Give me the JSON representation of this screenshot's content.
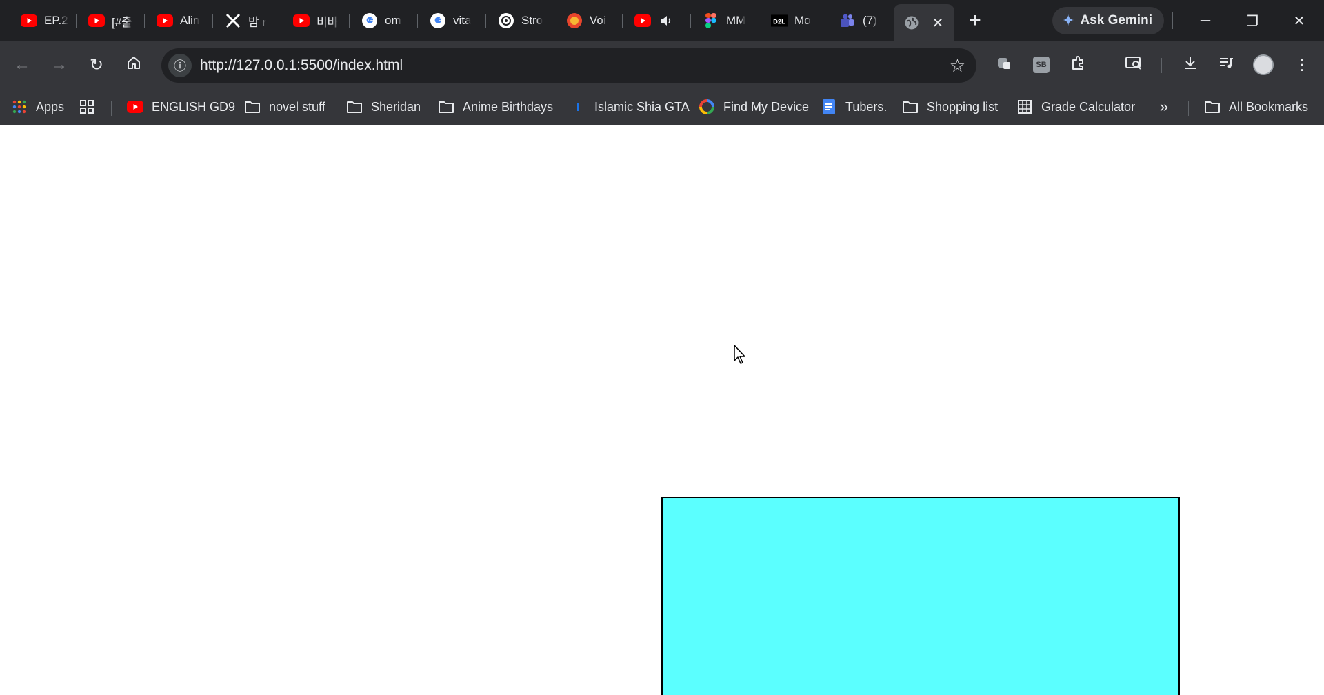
{
  "tabs": [
    {
      "title": "EP.2",
      "icon": "youtube-icon"
    },
    {
      "title": "[#출",
      "icon": "youtube-icon"
    },
    {
      "title": "Alin",
      "icon": "youtube-icon"
    },
    {
      "title": "밤 r",
      "icon": "x-icon"
    },
    {
      "title": "비바",
      "icon": "youtube-icon"
    },
    {
      "title": "om",
      "icon": "google-icon"
    },
    {
      "title": "vita",
      "icon": "google-icon"
    },
    {
      "title": "Stro",
      "icon": "openai-icon"
    },
    {
      "title": "Voi",
      "icon": "site-icon"
    },
    {
      "title": "",
      "icon": "youtube-icon",
      "audio": "speaker-icon"
    },
    {
      "title": "MM",
      "icon": "figma-icon"
    },
    {
      "title": "Mo",
      "icon": "d2l-icon"
    },
    {
      "title": "(7)",
      "icon": "teams-icon"
    }
  ],
  "active_tab": {
    "title": "",
    "icon": "globe-icon"
  },
  "gemini_label": "Ask Gemini",
  "address": {
    "url": "http://127.0.0.1:5500/index.html"
  },
  "bookmarks": [
    {
      "label": "Apps",
      "icon": "apps-grid-icon"
    },
    {
      "label": "ENGLISH GD9",
      "icon": "youtube-icon"
    },
    {
      "label": "novel stuff",
      "icon": "folder-icon"
    },
    {
      "label": "Sheridan",
      "icon": "folder-icon"
    },
    {
      "label": "Anime Birthdays",
      "icon": "folder-icon"
    },
    {
      "label": "Islamic Shia GTA",
      "icon": "site-icon"
    },
    {
      "label": "Find My Device",
      "icon": "google-icon"
    },
    {
      "label": "Tubers.",
      "icon": "docs-icon"
    },
    {
      "label": "Shopping list",
      "icon": "folder-icon"
    },
    {
      "label": "Grade Calculator",
      "icon": "calculator-icon"
    },
    {
      "label": "All Bookmarks",
      "icon": "folder-icon"
    }
  ],
  "colors": {
    "box_fill": "#5bffff",
    "box_border": "#000000",
    "chrome_dark": "#202124",
    "chrome": "#35363a"
  }
}
